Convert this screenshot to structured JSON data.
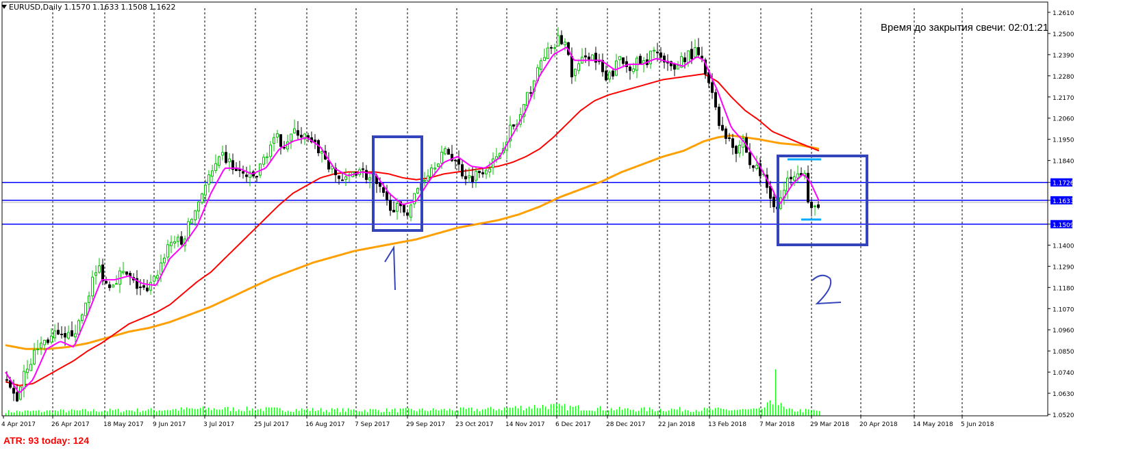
{
  "symbol": {
    "name": "EURUSD,Daily",
    "open": "1.1570",
    "high": "1.1633",
    "low": "1.1508",
    "close": "1.1622"
  },
  "timer_text": "Время до закрытия свечи: 02:01:21",
  "atr_text": "ATR: 93  today: 124",
  "colors": {
    "grid": "#000000",
    "bull": "#00c000",
    "bear": "#000000",
    "ma_fast": "#ff00ff",
    "ma_mid": "#ff0000",
    "ma_slow": "#ffa000",
    "hline": "#0000ff",
    "box": "#3344bb",
    "cyan": "#00aaff",
    "volume": "#00ff00",
    "price_label_bg": "#0000ff"
  },
  "chart_data": {
    "type": "candlestick",
    "title": "EURUSD,Daily",
    "ylim": [
      1.052,
      1.268
    ],
    "y_ticks": [
      "1.2610",
      "1.2500",
      "1.2390",
      "1.2280",
      "1.2170",
      "1.2060",
      "1.1950",
      "1.1840",
      "1.1726",
      "1.1633",
      "1.1509",
      "1.1400",
      "1.1290",
      "1.1180",
      "1.1070",
      "1.0960",
      "1.0850",
      "1.0740",
      "1.0630",
      "1.0520"
    ],
    "y_tick_values": [
      1.261,
      1.25,
      1.239,
      1.228,
      1.217,
      1.206,
      1.195,
      1.184,
      1.1726,
      1.1633,
      1.1509,
      1.14,
      1.129,
      1.118,
      1.107,
      1.096,
      1.085,
      1.074,
      1.063,
      1.052
    ],
    "highlighted_levels": [
      1.1726,
      1.1633,
      1.1509
    ],
    "x_labels": [
      "4 Apr 2017",
      "26 Apr 2017",
      "18 May 2017",
      "9 Jun 2017",
      "3 Jul 2017",
      "25 Jul 2017",
      "16 Aug 2017",
      "7 Sep 2017",
      "29 Sep 2017",
      "23 Oct 2017",
      "14 Nov 2017",
      "6 Dec 2017",
      "28 Dec 2017",
      "22 Jan 2018",
      "13 Feb 2018",
      "7 Mar 2018",
      "29 Mar 2018",
      "20 Apr 2018",
      "14 May 2018",
      "5 Jun 2018"
    ],
    "close_path": [
      [
        0,
        1.07
      ],
      [
        10,
        1.065
      ],
      [
        20,
        1.06
      ],
      [
        30,
        1.075
      ],
      [
        40,
        1.08
      ],
      [
        50,
        1.087
      ],
      [
        60,
        1.09
      ],
      [
        75,
        1.093
      ],
      [
        90,
        1.09
      ],
      [
        100,
        1.095
      ],
      [
        110,
        1.098
      ],
      [
        120,
        1.11
      ],
      [
        130,
        1.122
      ],
      [
        140,
        1.128
      ],
      [
        150,
        1.12
      ],
      [
        160,
        1.121
      ],
      [
        170,
        1.125
      ],
      [
        180,
        1.124
      ],
      [
        190,
        1.12
      ],
      [
        200,
        1.118
      ],
      [
        210,
        1.115
      ],
      [
        220,
        1.122
      ],
      [
        230,
        1.13
      ],
      [
        240,
        1.14
      ],
      [
        250,
        1.143
      ],
      [
        260,
        1.14
      ],
      [
        270,
        1.15
      ],
      [
        280,
        1.158
      ],
      [
        290,
        1.168
      ],
      [
        300,
        1.175
      ],
      [
        310,
        1.18
      ],
      [
        320,
        1.186
      ],
      [
        330,
        1.183
      ],
      [
        340,
        1.178
      ],
      [
        350,
        1.177
      ],
      [
        360,
        1.175
      ],
      [
        370,
        1.176
      ],
      [
        380,
        1.185
      ],
      [
        390,
        1.192
      ],
      [
        400,
        1.195
      ],
      [
        410,
        1.193
      ],
      [
        420,
        1.197
      ],
      [
        430,
        1.199
      ],
      [
        440,
        1.196
      ],
      [
        450,
        1.192
      ],
      [
        460,
        1.19
      ],
      [
        470,
        1.185
      ],
      [
        480,
        1.178
      ],
      [
        490,
        1.175
      ],
      [
        500,
        1.173
      ],
      [
        510,
        1.178
      ],
      [
        520,
        1.18
      ],
      [
        530,
        1.176
      ],
      [
        540,
        1.173
      ],
      [
        550,
        1.168
      ],
      [
        560,
        1.162
      ],
      [
        570,
        1.16
      ],
      [
        580,
        1.158
      ],
      [
        590,
        1.158
      ],
      [
        600,
        1.165
      ],
      [
        610,
        1.173
      ],
      [
        620,
        1.178
      ],
      [
        630,
        1.183
      ],
      [
        640,
        1.187
      ],
      [
        650,
        1.188
      ],
      [
        660,
        1.184
      ],
      [
        670,
        1.178
      ],
      [
        680,
        1.175
      ],
      [
        690,
        1.177
      ],
      [
        700,
        1.18
      ],
      [
        710,
        1.182
      ],
      [
        720,
        1.184
      ],
      [
        730,
        1.193
      ],
      [
        740,
        1.2
      ],
      [
        750,
        1.203
      ],
      [
        760,
        1.211
      ],
      [
        770,
        1.222
      ],
      [
        780,
        1.23
      ],
      [
        790,
        1.24
      ],
      [
        800,
        1.24
      ],
      [
        810,
        1.247
      ],
      [
        820,
        1.245
      ],
      [
        830,
        1.229
      ],
      [
        840,
        1.232
      ],
      [
        850,
        1.24
      ],
      [
        860,
        1.238
      ],
      [
        870,
        1.233
      ],
      [
        880,
        1.225
      ],
      [
        890,
        1.23
      ],
      [
        900,
        1.237
      ],
      [
        910,
        1.233
      ],
      [
        920,
        1.234
      ],
      [
        930,
        1.235
      ],
      [
        940,
        1.233
      ],
      [
        950,
        1.244
      ],
      [
        960,
        1.236
      ],
      [
        970,
        1.232
      ],
      [
        980,
        1.232
      ],
      [
        990,
        1.237
      ],
      [
        1000,
        1.239
      ],
      [
        1010,
        1.24
      ],
      [
        1020,
        1.235
      ],
      [
        1030,
        1.223
      ],
      [
        1040,
        1.212
      ],
      [
        1050,
        1.198
      ],
      [
        1060,
        1.196
      ],
      [
        1070,
        1.19
      ],
      [
        1080,
        1.195
      ],
      [
        1090,
        1.182
      ],
      [
        1100,
        1.18
      ],
      [
        1110,
        1.175
      ],
      [
        1120,
        1.165
      ],
      [
        1130,
        1.16
      ],
      [
        1140,
        1.168
      ],
      [
        1150,
        1.177
      ],
      [
        1160,
        1.18
      ],
      [
        1170,
        1.177
      ],
      [
        1175,
        1.162
      ],
      [
        1180,
        1.157
      ],
      [
        1190,
        1.162
      ]
    ],
    "ma_fast": [
      [
        0,
        1.074
      ],
      [
        20,
        1.063
      ],
      [
        40,
        1.07
      ],
      [
        60,
        1.086
      ],
      [
        80,
        1.09
      ],
      [
        100,
        1.087
      ],
      [
        120,
        1.104
      ],
      [
        140,
        1.122
      ],
      [
        160,
        1.122
      ],
      [
        180,
        1.124
      ],
      [
        200,
        1.12
      ],
      [
        220,
        1.119
      ],
      [
        240,
        1.133
      ],
      [
        260,
        1.14
      ],
      [
        280,
        1.15
      ],
      [
        300,
        1.167
      ],
      [
        320,
        1.18
      ],
      [
        340,
        1.18
      ],
      [
        360,
        1.177
      ],
      [
        380,
        1.18
      ],
      [
        400,
        1.19
      ],
      [
        420,
        1.194
      ],
      [
        440,
        1.196
      ],
      [
        460,
        1.191
      ],
      [
        480,
        1.18
      ],
      [
        500,
        1.176
      ],
      [
        520,
        1.178
      ],
      [
        540,
        1.177
      ],
      [
        560,
        1.167
      ],
      [
        580,
        1.161
      ],
      [
        600,
        1.163
      ],
      [
        620,
        1.174
      ],
      [
        640,
        1.183
      ],
      [
        660,
        1.186
      ],
      [
        680,
        1.181
      ],
      [
        700,
        1.18
      ],
      [
        720,
        1.185
      ],
      [
        740,
        1.197
      ],
      [
        760,
        1.21
      ],
      [
        780,
        1.228
      ],
      [
        800,
        1.239
      ],
      [
        820,
        1.243
      ],
      [
        830,
        1.236
      ],
      [
        850,
        1.236
      ],
      [
        870,
        1.236
      ],
      [
        890,
        1.231
      ],
      [
        910,
        1.234
      ],
      [
        930,
        1.234
      ],
      [
        950,
        1.237
      ],
      [
        970,
        1.235
      ],
      [
        990,
        1.233
      ],
      [
        1010,
        1.238
      ],
      [
        1020,
        1.236
      ],
      [
        1040,
        1.22
      ],
      [
        1060,
        1.201
      ],
      [
        1080,
        1.193
      ],
      [
        1100,
        1.182
      ],
      [
        1120,
        1.169
      ],
      [
        1130,
        1.161
      ],
      [
        1150,
        1.172
      ],
      [
        1165,
        1.177
      ],
      [
        1175,
        1.173
      ],
      [
        1188,
        1.163
      ]
    ],
    "ma_mid": [
      [
        0,
        1.069
      ],
      [
        20,
        1.067
      ],
      [
        40,
        1.068
      ],
      [
        60,
        1.072
      ],
      [
        80,
        1.076
      ],
      [
        100,
        1.08
      ],
      [
        120,
        1.085
      ],
      [
        140,
        1.089
      ],
      [
        160,
        1.094
      ],
      [
        180,
        1.099
      ],
      [
        200,
        1.102
      ],
      [
        220,
        1.105
      ],
      [
        240,
        1.109
      ],
      [
        260,
        1.115
      ],
      [
        280,
        1.121
      ],
      [
        300,
        1.126
      ],
      [
        320,
        1.133
      ],
      [
        340,
        1.14
      ],
      [
        360,
        1.147
      ],
      [
        380,
        1.154
      ],
      [
        400,
        1.161
      ],
      [
        420,
        1.167
      ],
      [
        440,
        1.171
      ],
      [
        460,
        1.175
      ],
      [
        480,
        1.177
      ],
      [
        500,
        1.178
      ],
      [
        520,
        1.178
      ],
      [
        540,
        1.178
      ],
      [
        560,
        1.177
      ],
      [
        580,
        1.175
      ],
      [
        600,
        1.174
      ],
      [
        620,
        1.175
      ],
      [
        640,
        1.177
      ],
      [
        660,
        1.178
      ],
      [
        680,
        1.179
      ],
      [
        700,
        1.18
      ],
      [
        720,
        1.181
      ],
      [
        740,
        1.183
      ],
      [
        760,
        1.186
      ],
      [
        780,
        1.19
      ],
      [
        800,
        1.196
      ],
      [
        820,
        1.203
      ],
      [
        840,
        1.21
      ],
      [
        860,
        1.215
      ],
      [
        880,
        1.218
      ],
      [
        900,
        1.22
      ],
      [
        920,
        1.222
      ],
      [
        940,
        1.224
      ],
      [
        960,
        1.226
      ],
      [
        980,
        1.227
      ],
      [
        1000,
        1.228
      ],
      [
        1020,
        1.229
      ],
      [
        1040,
        1.225
      ],
      [
        1060,
        1.217
      ],
      [
        1080,
        1.21
      ],
      [
        1100,
        1.205
      ],
      [
        1120,
        1.199
      ],
      [
        1140,
        1.196
      ],
      [
        1160,
        1.193
      ],
      [
        1188,
        1.189
      ]
    ],
    "ma_slow": [
      [
        0,
        1.088
      ],
      [
        30,
        1.086
      ],
      [
        60,
        1.086
      ],
      [
        90,
        1.087
      ],
      [
        120,
        1.089
      ],
      [
        150,
        1.092
      ],
      [
        180,
        1.095
      ],
      [
        210,
        1.097
      ],
      [
        240,
        1.1
      ],
      [
        270,
        1.104
      ],
      [
        300,
        1.108
      ],
      [
        330,
        1.113
      ],
      [
        360,
        1.118
      ],
      [
        390,
        1.123
      ],
      [
        420,
        1.127
      ],
      [
        450,
        1.131
      ],
      [
        480,
        1.134
      ],
      [
        510,
        1.137
      ],
      [
        540,
        1.139
      ],
      [
        570,
        1.141
      ],
      [
        600,
        1.143
      ],
      [
        630,
        1.146
      ],
      [
        660,
        1.149
      ],
      [
        690,
        1.151
      ],
      [
        720,
        1.153
      ],
      [
        750,
        1.156
      ],
      [
        780,
        1.16
      ],
      [
        810,
        1.165
      ],
      [
        840,
        1.169
      ],
      [
        870,
        1.173
      ],
      [
        900,
        1.178
      ],
      [
        930,
        1.182
      ],
      [
        960,
        1.186
      ],
      [
        990,
        1.189
      ],
      [
        1020,
        1.194
      ],
      [
        1040,
        1.196
      ],
      [
        1060,
        1.197
      ],
      [
        1080,
        1.196
      ],
      [
        1100,
        1.195
      ],
      [
        1130,
        1.193
      ],
      [
        1160,
        1.192
      ],
      [
        1188,
        1.19
      ]
    ],
    "volume_profile": [
      [
        0,
        0.3
      ],
      [
        100,
        0.35
      ],
      [
        200,
        0.4
      ],
      [
        300,
        0.5
      ],
      [
        400,
        0.45
      ],
      [
        500,
        0.4
      ],
      [
        600,
        0.4
      ],
      [
        700,
        0.45
      ],
      [
        790,
        0.7
      ],
      [
        820,
        0.6
      ],
      [
        900,
        0.45
      ],
      [
        1000,
        0.45
      ],
      [
        1100,
        0.4
      ],
      [
        1124,
        1.0
      ],
      [
        1140,
        0.4
      ],
      [
        1190,
        0.35
      ]
    ]
  },
  "annotations": {
    "box1_label": "1",
    "box2_label": "2"
  }
}
